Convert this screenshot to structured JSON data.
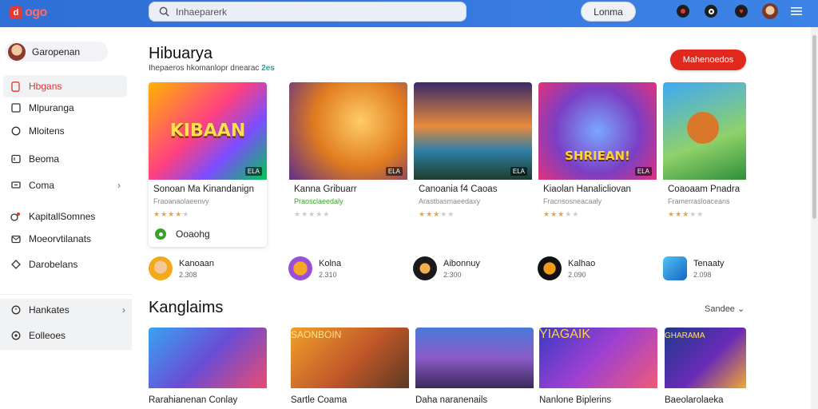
{
  "header": {
    "logo_text": "ogo",
    "logo_mark": "d",
    "search_placeholder": "Inhaeparerk",
    "button_label": "Lonma",
    "icons": [
      "dark-round-icon",
      "camera-icon",
      "heart-badge-icon",
      "user-avatar-icon",
      "hamburger-menu-icon"
    ]
  },
  "sidebar": {
    "profile_name": "Garopenan",
    "items": [
      {
        "label": "Hbgans",
        "icon": "phone-icon",
        "active": true
      },
      {
        "label": "Mlpuranga",
        "icon": "tablet-icon",
        "active": false
      },
      {
        "label": "Mloitens",
        "icon": "chat-icon",
        "active": false
      },
      {
        "label": "Beoma",
        "icon": "book-icon",
        "active": false
      },
      {
        "label": "Coma",
        "icon": "monitor-icon",
        "active": false,
        "chevron": true
      },
      {
        "label": "KapitallSomnes",
        "icon": "gamepad-icon",
        "active": false
      },
      {
        "label": "Moeorvtilanats",
        "icon": "envelope-icon",
        "active": false
      },
      {
        "label": "Darobelans",
        "icon": "tag-icon",
        "active": false
      },
      {
        "label": "Hankates",
        "icon": "clock-icon",
        "active": false,
        "chevron": true
      },
      {
        "label": "Eolleoes",
        "icon": "settings-icon",
        "active": false
      }
    ]
  },
  "section1": {
    "title": "Hibuarya",
    "subtitle": "Ihepaeros hkomanlopr dnearac",
    "subtitle_accent": "2es",
    "action_button": "Mahenoedos",
    "cards": [
      {
        "title": "Sonoan Ma Kinandanign",
        "sub": "Fraoanaolaeenvy",
        "sub_green": false,
        "rating": 4,
        "badge": "ELA",
        "art_text": "KIBAAN"
      },
      {
        "title": "Kanna Gribuarr",
        "sub": "Praosclaeedaly",
        "sub_green": true,
        "rating": 0,
        "badge": "ELA",
        "art_text": ""
      },
      {
        "title": "Canoania f4 Caoas",
        "sub": "Arastbasmaeedaxy",
        "sub_green": false,
        "rating": 3,
        "badge": "ELA",
        "art_text": ""
      },
      {
        "title": "Kiaolan Hanalicliovan",
        "sub": "Fracnsosneacaaly",
        "sub_green": false,
        "rating": 3,
        "badge": "ELA",
        "art_text": "SHRIEAN!"
      },
      {
        "title": "Coaoaam Pnadra",
        "sub": "Framerrasloaceans",
        "sub_green": false,
        "rating": 3,
        "badge": "",
        "art_text": ""
      }
    ],
    "first_card_action": "Ooaohg"
  },
  "apps": [
    {
      "name": "Kanoaan",
      "count": "2.308"
    },
    {
      "name": "Kolna",
      "count": "2.310"
    },
    {
      "name": "Aibonnuy",
      "count": "2:300"
    },
    {
      "name": "Kalhao",
      "count": "2.090"
    },
    {
      "name": "Tenaaty",
      "count": "2.098"
    }
  ],
  "section2": {
    "title": "Kanglaims",
    "sort_label": "Sandee",
    "cards": [
      {
        "title": "Rarahianenan Conlay"
      },
      {
        "title": "Sartle Coama",
        "art_text": "SAONBOIN"
      },
      {
        "title": "Daha naranenails"
      },
      {
        "title": "Nanlone Biplerins",
        "art_text": "YIAGAIK"
      },
      {
        "title": "Baeolarolaeka",
        "art_text": "GHARAMA"
      }
    ]
  },
  "colors": {
    "topbar": "#3d83e6",
    "accent_red": "#e0281d",
    "active_nav": "#d33333",
    "accent_teal": "#1ba8a0",
    "star": "#e8a33a"
  }
}
